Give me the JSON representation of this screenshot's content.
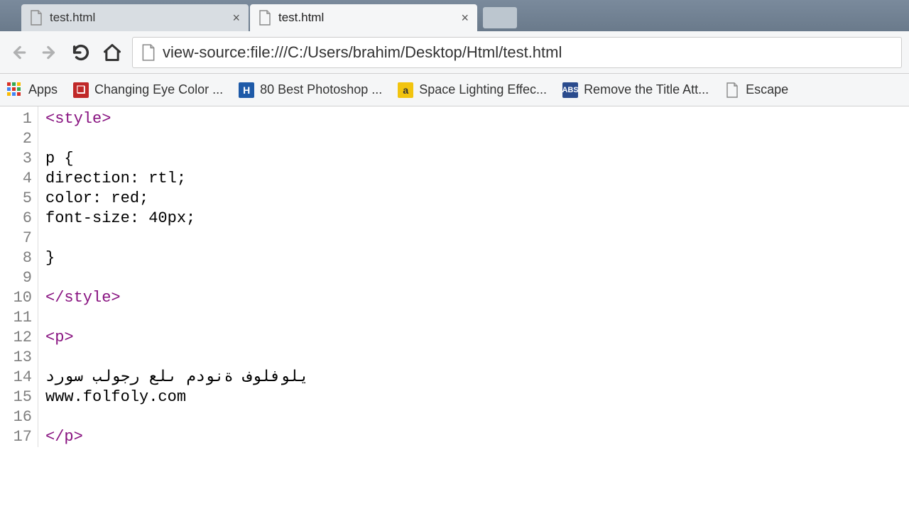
{
  "tabs": [
    {
      "title": "test.html"
    },
    {
      "title": "test.html"
    }
  ],
  "address": "view-source:file:///C:/Users/brahim/Desktop/Html/test.html",
  "bookmarks": {
    "apps": "Apps",
    "b1": "Changing Eye Color ...",
    "b2": "80 Best Photoshop ...",
    "b3": "Space Lighting Effec...",
    "b4": "Remove the Title Att...",
    "b5": "Escape"
  },
  "source": {
    "l1a": "<style>",
    "l2": "",
    "l3": "p {",
    "l4": "direction: rtl;",
    "l5": "color: red;",
    "l6": "font-size: 40px;",
    "l7": "",
    "l8": "}",
    "l9": "",
    "l10a": "</style>",
    "l11": "",
    "l12a": "<p>",
    "l13": "",
    "l14": "دروس بلوجر على مدونة فولفولي",
    "l15": "www.folfoly.com",
    "l16": "",
    "l17a": "</p>"
  },
  "line_numbers": [
    "1",
    "2",
    "3",
    "4",
    "5",
    "6",
    "7",
    "8",
    "9",
    "10",
    "11",
    "12",
    "13",
    "14",
    "15",
    "16",
    "17"
  ]
}
